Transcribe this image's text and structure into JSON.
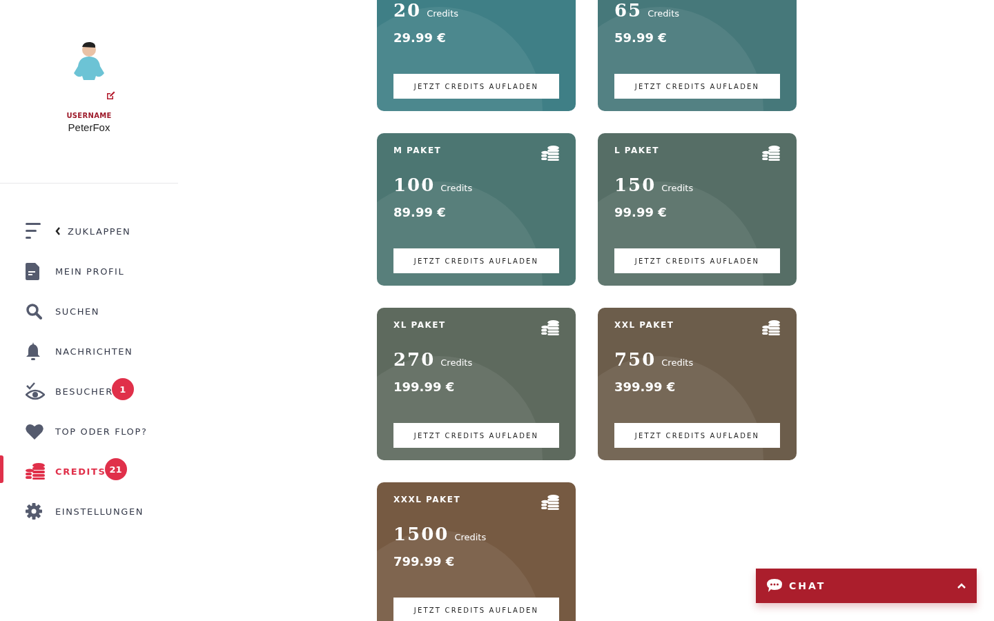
{
  "profile": {
    "label": "USERNAME",
    "username": "PeterFox"
  },
  "nav": [
    {
      "kind": "collapse",
      "label": "ZUKLAPPEN",
      "selected": false
    },
    {
      "kind": "profile",
      "label": "MEIN PROFIL",
      "selected": false
    },
    {
      "kind": "search",
      "label": "SUCHEN",
      "selected": false
    },
    {
      "kind": "bell",
      "label": "NACHRICHTEN",
      "selected": false
    },
    {
      "kind": "eye",
      "label": "BESUCHER",
      "badge": "1",
      "selected": false
    },
    {
      "kind": "heart",
      "label": "TOP ODER FLOP?",
      "selected": false
    },
    {
      "kind": "coins",
      "label": "CREDITS",
      "badge": "21",
      "selected": true
    },
    {
      "kind": "gear",
      "label": "EINSTELLUNGEN",
      "selected": false
    }
  ],
  "packages": [
    {
      "credits": "20",
      "unit": "Credits",
      "price": "29.99 €",
      "button": "JETZT CREDITS AUFLADEN",
      "color": "#3f7f86"
    },
    {
      "credits": "65",
      "unit": "Credits",
      "price": "59.99 €",
      "button": "JETZT CREDITS AUFLADEN",
      "color": "#46787a"
    },
    {
      "name": "M PAKET",
      "credits": "100",
      "unit": "Credits",
      "price": "89.99 €",
      "button": "JETZT CREDITS AUFLADEN",
      "color": "#4c7672"
    },
    {
      "name": "L PAKET",
      "credits": "150",
      "unit": "Credits",
      "price": "99.99 €",
      "button": "JETZT CREDITS AUFLADEN",
      "color": "#566e66"
    },
    {
      "name": "XL PAKET",
      "credits": "270",
      "unit": "Credits",
      "price": "199.99 €",
      "button": "JETZT CREDITS AUFLADEN",
      "color": "#5e6a5e"
    },
    {
      "name": "XXL PAKET",
      "credits": "750",
      "unit": "Credits",
      "price": "399.99 €",
      "button": "JETZT CREDITS AUFLADEN",
      "color": "#6c5d4b"
    },
    {
      "name": "XXXL PAKET",
      "credits": "1500",
      "unit": "Credits",
      "price": "799.99 €",
      "button": "JETZT CREDITS AUFLADEN",
      "color": "#765a42"
    }
  ],
  "chat": {
    "label": "CHAT"
  }
}
